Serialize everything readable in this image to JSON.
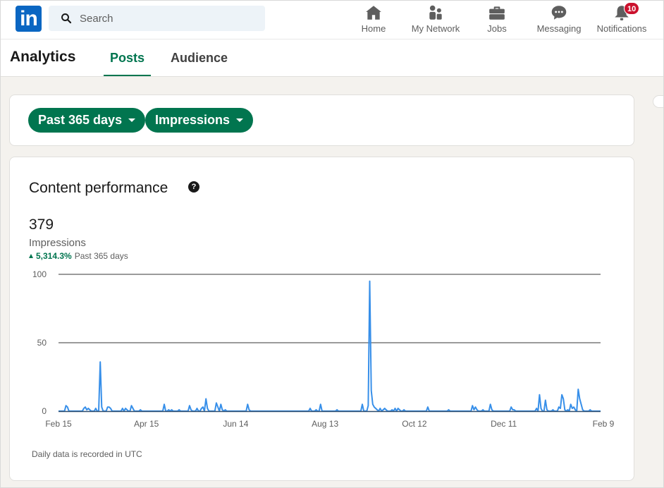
{
  "app": {
    "brand": "in"
  },
  "topnav": {
    "search_placeholder": "Search",
    "items": [
      {
        "label": "Home",
        "icon": "home-icon"
      },
      {
        "label": "My Network",
        "icon": "network-icon"
      },
      {
        "label": "Jobs",
        "icon": "briefcase-icon"
      },
      {
        "label": "Messaging",
        "icon": "message-icon"
      },
      {
        "label": "Notifications",
        "icon": "bell-icon",
        "badge": "10"
      }
    ]
  },
  "subheader": {
    "title": "Analytics",
    "tabs": [
      {
        "label": "Posts",
        "active": true
      },
      {
        "label": "Audience",
        "active": false
      }
    ]
  },
  "filters": {
    "range": "Past 365 days",
    "metric": "Impressions"
  },
  "content": {
    "title": "Content performance",
    "help_icon": "?",
    "total": "379",
    "metric_label": "Impressions",
    "change": "5,314.3%",
    "change_period": "Past 365 days",
    "footnote": "Daily data is recorded in UTC"
  },
  "colors": {
    "accent": "#01754f",
    "brand": "#0a66c2",
    "line": "#378fe9",
    "badge": "#cb112d"
  },
  "chart_data": {
    "type": "line",
    "title": "Content performance",
    "ylabel": "Impressions",
    "xlabel": "",
    "ylim": [
      0,
      100
    ],
    "yticks": [
      0,
      50,
      100
    ],
    "xtick_labels": [
      "Feb 15",
      "Apr 15",
      "Jun 14",
      "Aug 13",
      "Oct 12",
      "Dec 11",
      "Feb 9"
    ],
    "xtick_days": [
      0,
      59,
      119,
      179,
      239,
      299,
      359
    ],
    "grid": true,
    "days": 365,
    "series": [
      {
        "name": "Impressions",
        "spikes": [
          [
            5,
            4
          ],
          [
            6,
            3
          ],
          [
            17,
            2
          ],
          [
            18,
            3
          ],
          [
            19,
            1
          ],
          [
            20,
            2
          ],
          [
            21,
            1
          ],
          [
            25,
            2
          ],
          [
            28,
            36
          ],
          [
            29,
            3
          ],
          [
            33,
            3
          ],
          [
            34,
            3
          ],
          [
            35,
            2
          ],
          [
            43,
            2
          ],
          [
            45,
            2
          ],
          [
            46,
            1
          ],
          [
            49,
            4
          ],
          [
            50,
            2
          ],
          [
            55,
            1
          ],
          [
            71,
            5
          ],
          [
            74,
            1
          ],
          [
            76,
            1
          ],
          [
            81,
            1
          ],
          [
            88,
            4
          ],
          [
            89,
            1
          ],
          [
            93,
            2
          ],
          [
            96,
            2
          ],
          [
            97,
            3
          ],
          [
            99,
            9
          ],
          [
            100,
            2
          ],
          [
            106,
            6
          ],
          [
            107,
            3
          ],
          [
            109,
            5
          ],
          [
            110,
            1
          ],
          [
            112,
            1
          ],
          [
            127,
            5
          ],
          [
            128,
            1
          ],
          [
            169,
            2
          ],
          [
            173,
            1
          ],
          [
            176,
            5
          ],
          [
            187,
            1
          ],
          [
            204,
            5
          ],
          [
            208,
            4
          ],
          [
            209,
            95
          ],
          [
            210,
            15
          ],
          [
            211,
            5
          ],
          [
            212,
            3
          ],
          [
            213,
            2
          ],
          [
            214,
            1
          ],
          [
            216,
            2
          ],
          [
            218,
            1
          ],
          [
            219,
            2
          ],
          [
            220,
            1
          ],
          [
            224,
            1
          ],
          [
            226,
            2
          ],
          [
            228,
            2
          ],
          [
            229,
            1
          ],
          [
            232,
            1
          ],
          [
            248,
            3
          ],
          [
            262,
            1
          ],
          [
            278,
            4
          ],
          [
            279,
            1
          ],
          [
            280,
            3
          ],
          [
            281,
            1
          ],
          [
            285,
            1
          ],
          [
            290,
            5
          ],
          [
            291,
            1
          ],
          [
            304,
            3
          ],
          [
            305,
            1
          ],
          [
            306,
            1
          ],
          [
            321,
            2
          ],
          [
            323,
            12
          ],
          [
            324,
            2
          ],
          [
            327,
            8
          ],
          [
            328,
            1
          ],
          [
            332,
            1
          ],
          [
            336,
            3
          ],
          [
            337,
            2
          ],
          [
            338,
            12
          ],
          [
            339,
            9
          ],
          [
            340,
            1
          ],
          [
            342,
            1
          ],
          [
            344,
            5
          ],
          [
            345,
            2
          ],
          [
            346,
            3
          ],
          [
            347,
            1
          ],
          [
            349,
            16
          ],
          [
            350,
            9
          ],
          [
            351,
            5
          ],
          [
            352,
            1
          ],
          [
            357,
            1
          ]
        ]
      }
    ]
  }
}
